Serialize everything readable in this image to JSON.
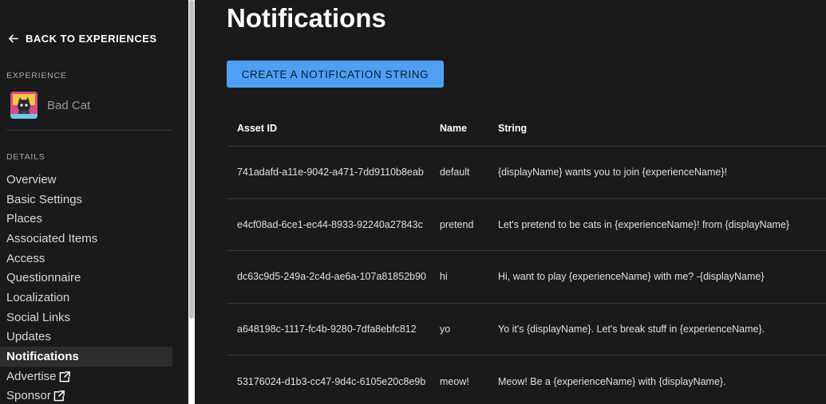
{
  "sidebar": {
    "back_label": "BACK TO EXPERIENCES",
    "experience_section": "EXPERIENCE",
    "experience_name": "Bad Cat",
    "details_section": "DETAILS",
    "items": [
      {
        "label": "Overview"
      },
      {
        "label": "Basic Settings"
      },
      {
        "label": "Places"
      },
      {
        "label": "Associated Items"
      },
      {
        "label": "Access"
      },
      {
        "label": "Questionnaire"
      },
      {
        "label": "Localization"
      },
      {
        "label": "Social Links"
      },
      {
        "label": "Updates"
      },
      {
        "label": "Notifications"
      },
      {
        "label": "Advertise"
      },
      {
        "label": "Sponsor"
      }
    ]
  },
  "main": {
    "title": "Notifications",
    "create_button": "CREATE A NOTIFICATION STRING",
    "table": {
      "headers": [
        "Asset ID",
        "Name",
        "String"
      ],
      "rows": [
        {
          "asset_id": "741adafd-a11e-9042-a471-7dd9110b8eab",
          "name": "default",
          "string": "{displayName} wants you to join {experienceName}!"
        },
        {
          "asset_id": "e4cf08ad-6ce1-ec44-8933-92240a27843c",
          "name": "pretend",
          "string": "Let's pretend to be cats in {experienceName}! from {displayName}"
        },
        {
          "asset_id": "dc63c9d5-249a-2c4d-ae6a-107a81852b90",
          "name": "hi",
          "string": "Hi, want to play {experienceName} with me? -{displayName}"
        },
        {
          "asset_id": "a648198c-1117-fc4b-9280-7dfa8ebfc812",
          "name": "yo",
          "string": "Yo it's {displayName}. Let's break stuff in {experienceName}."
        },
        {
          "asset_id": "53176024-d1b3-cc47-9d4c-6105e20c8e9b",
          "name": "meow!",
          "string": "Meow! Be a {experienceName} with {displayName}."
        }
      ]
    }
  },
  "colors": {
    "background": "#1a1a1a",
    "accent": "#4fa0f5",
    "active_nav": "#2b2d2f"
  }
}
